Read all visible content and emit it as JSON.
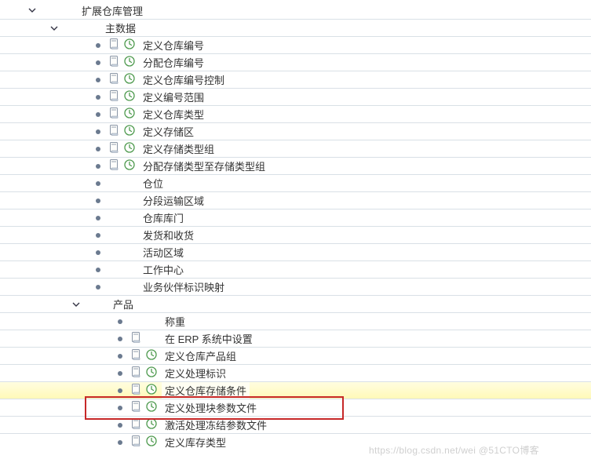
{
  "tree": {
    "root": {
      "label": "扩展仓库管理"
    },
    "masterdata": {
      "label": "主数据"
    },
    "items1": [
      {
        "label": "定义仓库编号",
        "doc": true,
        "clock": true
      },
      {
        "label": "分配仓库编号",
        "doc": true,
        "clock": true
      },
      {
        "label": "定义仓库编号控制",
        "doc": true,
        "clock": true
      },
      {
        "label": "定义编号范围",
        "doc": true,
        "clock": true
      },
      {
        "label": "定义仓库类型",
        "doc": true,
        "clock": true
      },
      {
        "label": "定义存储区",
        "doc": true,
        "clock": true
      },
      {
        "label": "定义存储类型组",
        "doc": true,
        "clock": true
      },
      {
        "label": "分配存储类型至存储类型组",
        "doc": true,
        "clock": true
      },
      {
        "label": "仓位",
        "doc": false,
        "clock": false
      },
      {
        "label": "分段运输区域",
        "doc": false,
        "clock": false
      },
      {
        "label": "仓库库门",
        "doc": false,
        "clock": false
      },
      {
        "label": "发货和收货",
        "doc": false,
        "clock": false
      },
      {
        "label": "活动区域",
        "doc": false,
        "clock": false
      },
      {
        "label": "工作中心",
        "doc": false,
        "clock": false
      },
      {
        "label": "业务伙伴标识映射",
        "doc": false,
        "clock": false
      }
    ],
    "product": {
      "label": "产品"
    },
    "items2": [
      {
        "label": "称重",
        "doc": false,
        "clock": false
      },
      {
        "label": "在 ERP 系统中设置",
        "doc": true,
        "clock": false
      },
      {
        "label": "定义仓库产品组",
        "doc": true,
        "clock": true
      },
      {
        "label": "定义处理标识",
        "doc": true,
        "clock": true
      },
      {
        "label": "定义仓库存储条件",
        "doc": true,
        "clock": true,
        "highlight": true
      },
      {
        "label": "定义处理块参数文件",
        "doc": true,
        "clock": true
      },
      {
        "label": "激活处理冻结参数文件",
        "doc": true,
        "clock": true
      },
      {
        "label": "定义库存类型",
        "doc": true,
        "clock": true
      }
    ]
  },
  "watermark": "https://blog.csdn.net/wei @51CTO博客"
}
